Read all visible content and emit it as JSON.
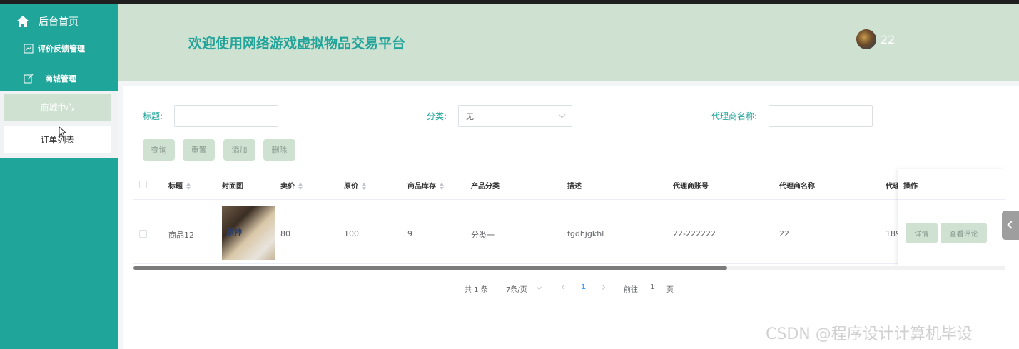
{
  "sidebar": {
    "home_label": "后台首页",
    "menu": [
      {
        "label": "评价反馈管理",
        "icon": "chart-icon"
      },
      {
        "label": "商城管理",
        "icon": "edit-icon"
      }
    ],
    "submenu": {
      "active": "商城中心",
      "item": "订单列表"
    }
  },
  "header": {
    "title": "欢迎使用网络游戏虚拟物品交易平台",
    "user": "22"
  },
  "search": {
    "title_label": "标题:",
    "title_value": "",
    "category_label": "分类:",
    "category_value": "无",
    "agent_label": "代理商名称:",
    "agent_value": ""
  },
  "buttons": {
    "query": "查询",
    "reset": "重置",
    "add": "添加",
    "delete": "删除"
  },
  "table": {
    "headers": [
      "标题",
      "封面图",
      "卖价",
      "原价",
      "商品库存",
      "产品分类",
      "描述",
      "代理商账号",
      "代理商名称",
      "代理",
      "操作"
    ],
    "rows": [
      {
        "title": "商品12",
        "cover_text": "原神",
        "price": "80",
        "original_price": "100",
        "stock": "9",
        "category": "分类一",
        "description": "fgdhjgkhl",
        "agent_account": "22-222222",
        "agent_name": "22",
        "agent_phone_partial": "189"
      }
    ],
    "row_actions": {
      "detail": "详情",
      "comments": "查看评论"
    }
  },
  "pagination": {
    "total": "共 1 条",
    "page_size": "7条/页",
    "current": "1",
    "goto_label": "前往",
    "goto_value": "1",
    "page_suffix": "页"
  },
  "watermark": "CSDN @程序设计计算机毕设",
  "colors": {
    "sidebar": "#20a59a",
    "header": "#cfe2d2",
    "accent": "#22a49a"
  }
}
